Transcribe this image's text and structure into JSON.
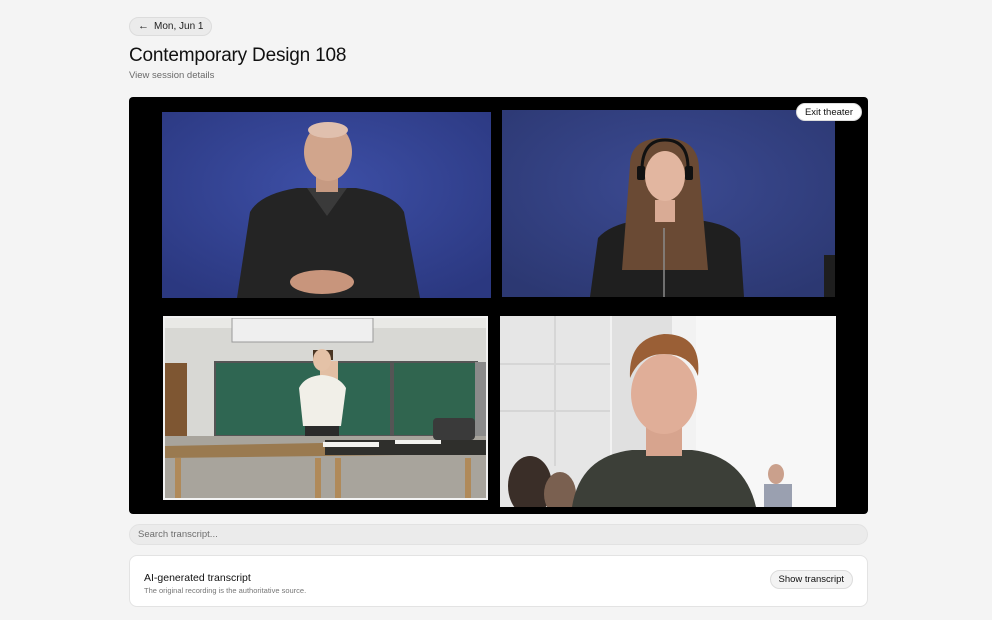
{
  "nav": {
    "back_label": "Mon, Jun 1",
    "back_icon": "arrow-left-icon"
  },
  "header": {
    "title": "Contemporary Design 108",
    "subtitle_link": "View session details"
  },
  "theater": {
    "exit_label": "Exit theater",
    "background": "#000000",
    "feeds": [
      {
        "name": "asl-interpreter-man",
        "background": "#32418f"
      },
      {
        "name": "asl-interpreter-woman",
        "background": "#33407f"
      },
      {
        "name": "lecturer-classroom",
        "background": "#d9d9d4"
      },
      {
        "name": "student",
        "background": "#ececec"
      }
    ]
  },
  "search": {
    "placeholder": "Search transcript..."
  },
  "transcript": {
    "title": "AI-generated transcript",
    "subtitle": "The original recording is the authoritative source.",
    "show_label": "Show transcript"
  }
}
